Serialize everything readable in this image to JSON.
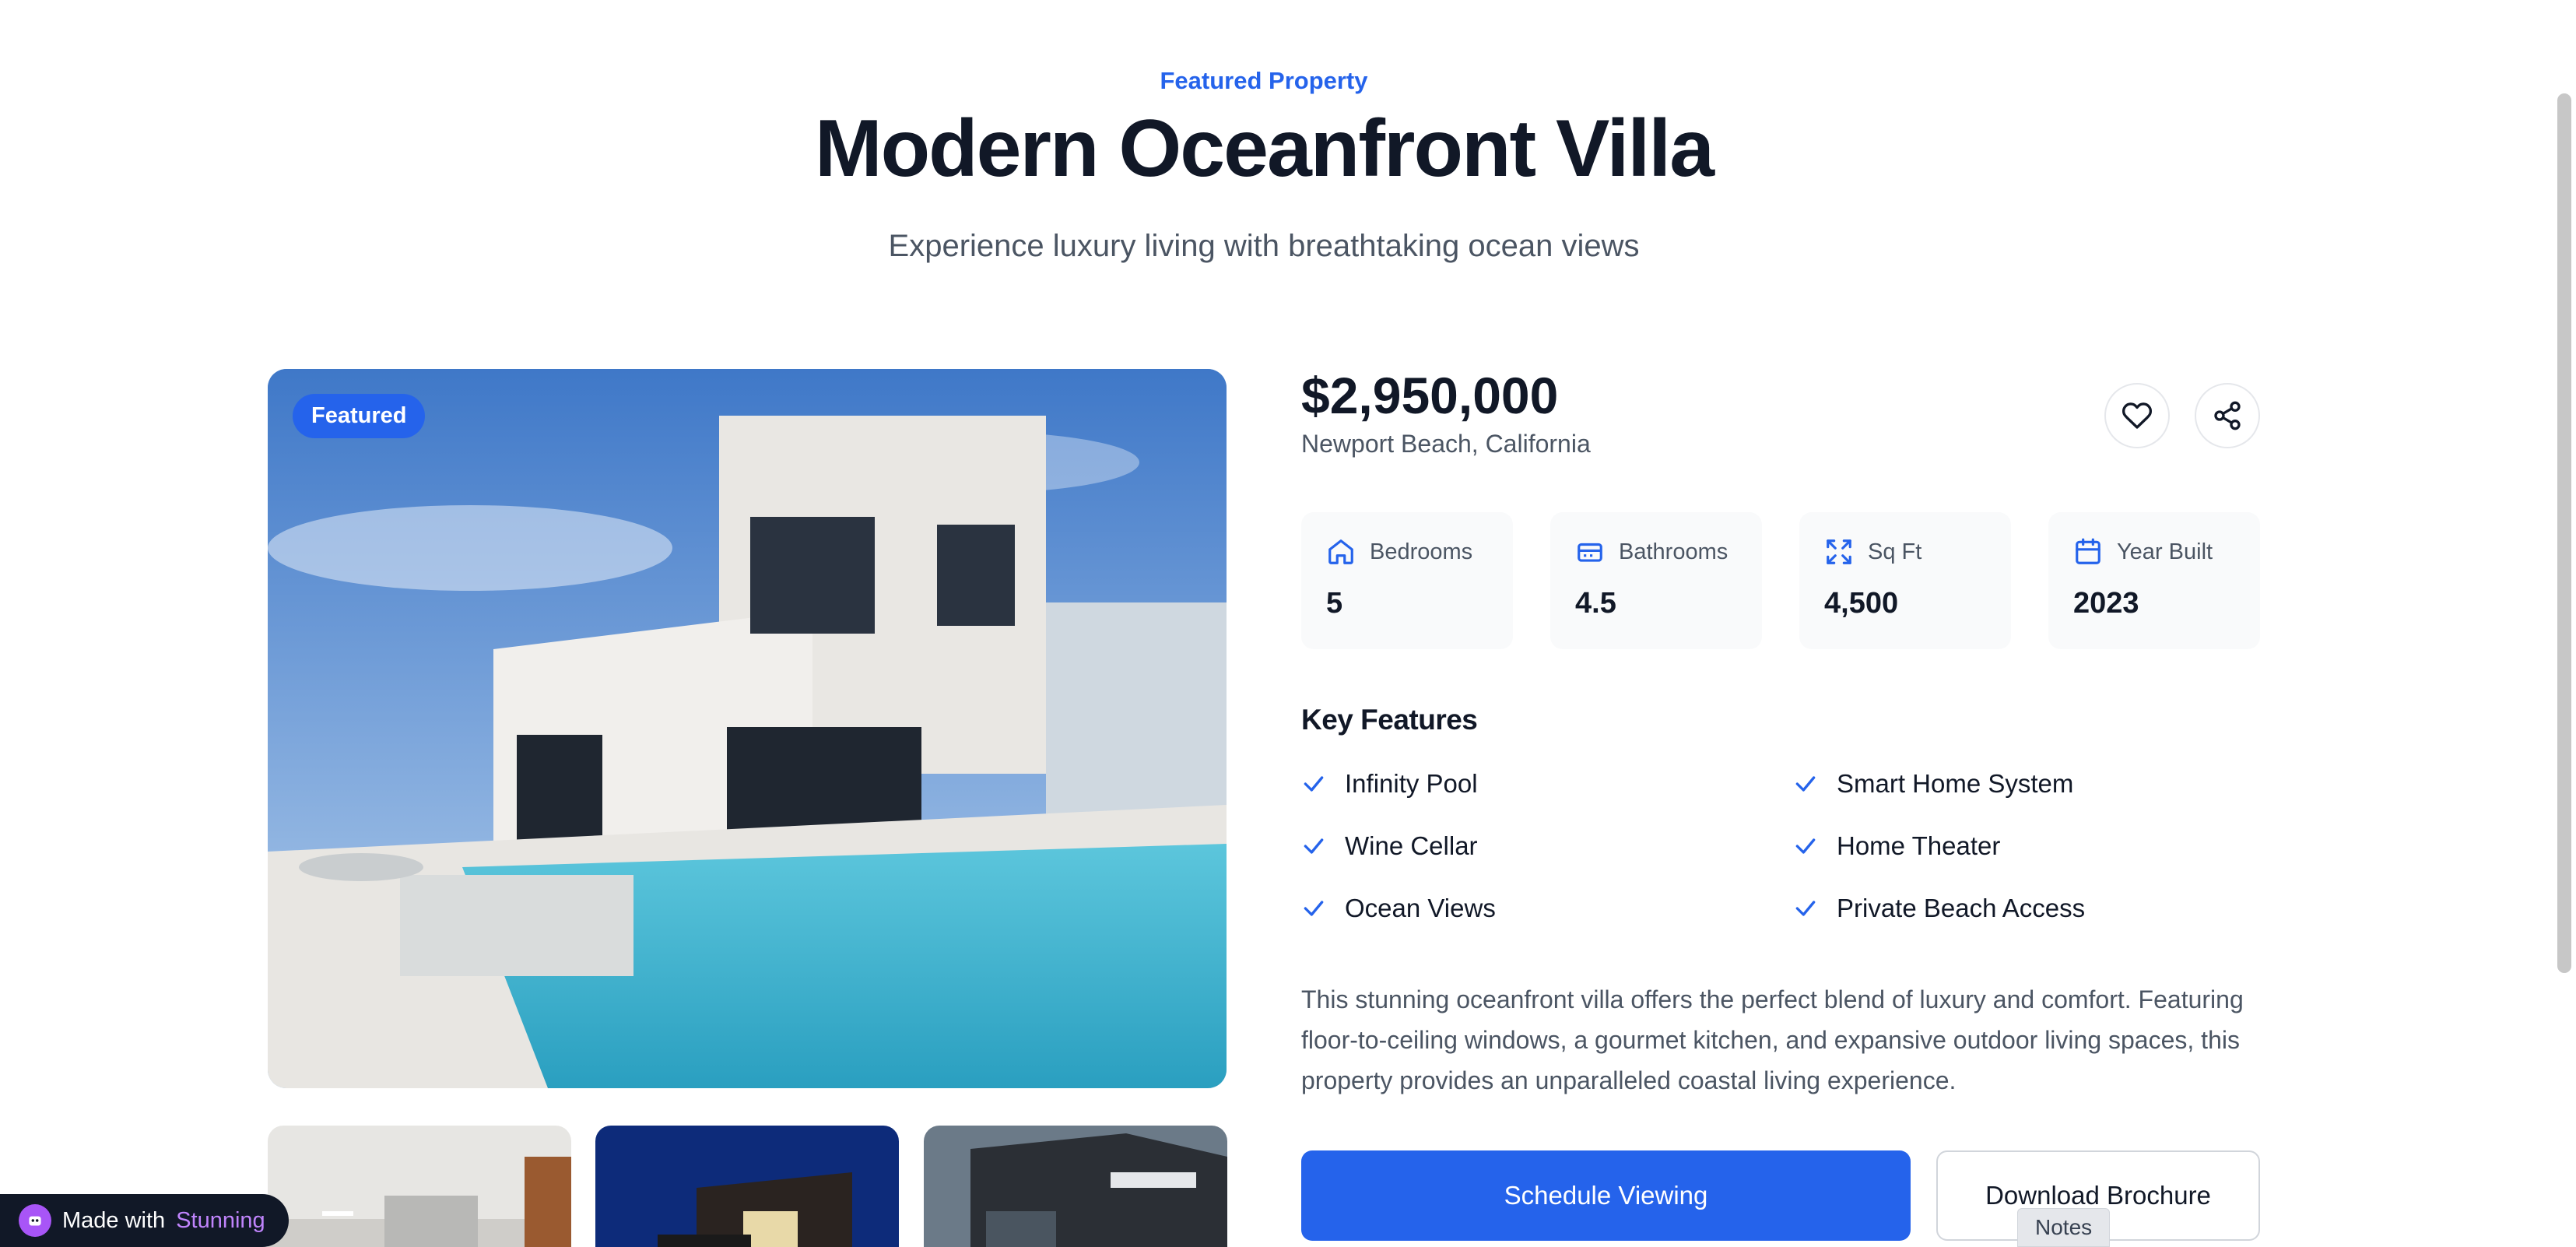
{
  "header": {
    "eyebrow": "Featured Property",
    "title": "Modern Oceanfront Villa",
    "subtitle": "Experience luxury living with breathtaking ocean views"
  },
  "gallery": {
    "badge": "Featured",
    "thumbnail_count": 3
  },
  "listing": {
    "price": "$2,950,000",
    "location": "Newport Beach, California",
    "stats": [
      {
        "label": "Bedrooms",
        "value": "5",
        "icon": "home-icon"
      },
      {
        "label": "Bathrooms",
        "value": "4.5",
        "icon": "bath-icon"
      },
      {
        "label": "Sq Ft",
        "value": "4,500",
        "icon": "expand-icon"
      },
      {
        "label": "Year Built",
        "value": "2023",
        "icon": "calendar-icon"
      }
    ]
  },
  "features": {
    "title": "Key Features",
    "items": [
      "Infinity Pool",
      "Smart Home System",
      "Wine Cellar",
      "Home Theater",
      "Ocean Views",
      "Private Beach Access"
    ]
  },
  "description": "This stunning oceanfront villa offers the perfect blend of luxury and comfort. Featuring floor-to-ceiling windows, a gourmet kitchen, and expansive outdoor living spaces, this property provides an unparalleled coastal living experience.",
  "actions": {
    "primary": "Schedule Viewing",
    "secondary": "Download Brochure"
  },
  "overlay": {
    "notes": "Notes",
    "made_prefix": "Made with",
    "made_brand": "Stunning"
  },
  "colors": {
    "accent": "#2563eb",
    "text": "#111827",
    "muted": "#4b5563",
    "stat_bg": "#f9fafb"
  }
}
